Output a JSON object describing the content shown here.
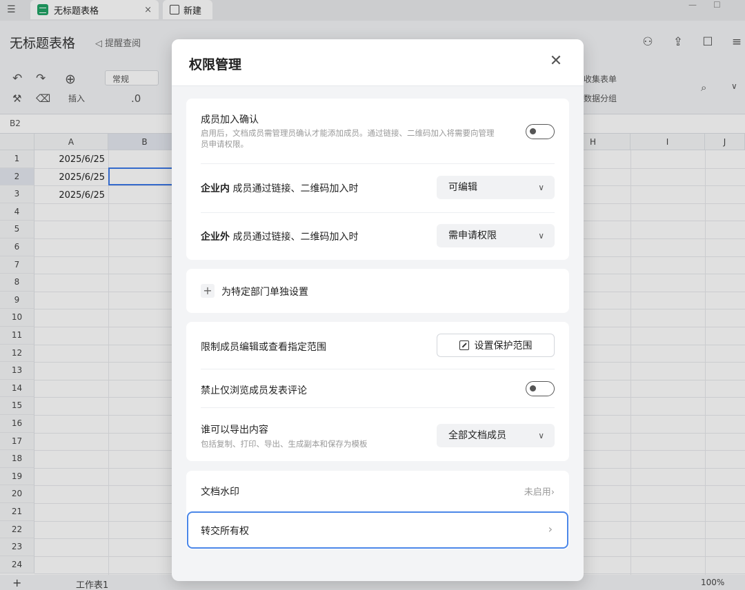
{
  "tabs": [
    {
      "label": "无标题表格",
      "close": "×"
    },
    {
      "label": "新建"
    }
  ],
  "doc": {
    "title": "无标题表格",
    "remind": "提醒查阅"
  },
  "toolbar": {
    "insert_label": "插入",
    "format_value": "常规",
    "decimal": ".0",
    "collect_form": "收集表单",
    "data_group": "数据分组"
  },
  "formula": {
    "cellref": "B2"
  },
  "grid": {
    "columns": [
      "A",
      "B",
      "H",
      "I",
      "J"
    ],
    "rows": [
      "1",
      "2",
      "3",
      "4",
      "5",
      "6",
      "7",
      "8",
      "9",
      "10",
      "11",
      "12",
      "13",
      "14",
      "15",
      "16",
      "17",
      "18",
      "19",
      "20",
      "21",
      "22",
      "23",
      "24"
    ],
    "values": [
      "2025/6/25",
      "2025/6/25",
      "2025/6/25"
    ]
  },
  "sheetbar": {
    "sheet_name": "工作表1",
    "zoom": "100%"
  },
  "modal": {
    "title": "权限管理",
    "close": "✕",
    "member_confirm": {
      "title": "成员加入确认",
      "desc": "启用后，文档成员需管理员确认才能添加成员。通过链接、二维码加入将需要向管理员申请权限。"
    },
    "internal": {
      "bold": "企业内",
      "text": " 成员通过链接、二维码加入时",
      "value": "可编辑"
    },
    "external": {
      "bold": "企业外",
      "text": " 成员通过链接、二维码加入时",
      "value": "需申请权限"
    },
    "dept": {
      "label": "为特定部门单独设置"
    },
    "restrict": {
      "label": "限制成员编辑或查看指定范围",
      "button": "设置保护范围"
    },
    "no_comment": {
      "label": "禁止仅浏览成员发表评论"
    },
    "export": {
      "label": "谁可以导出内容",
      "desc": "包括复制、打印、导出、生成副本和保存为模板",
      "value": "全部文档成员"
    },
    "watermark": {
      "label": "文档水印",
      "status": "未启用"
    },
    "transfer": {
      "label": "转交所有权"
    }
  }
}
